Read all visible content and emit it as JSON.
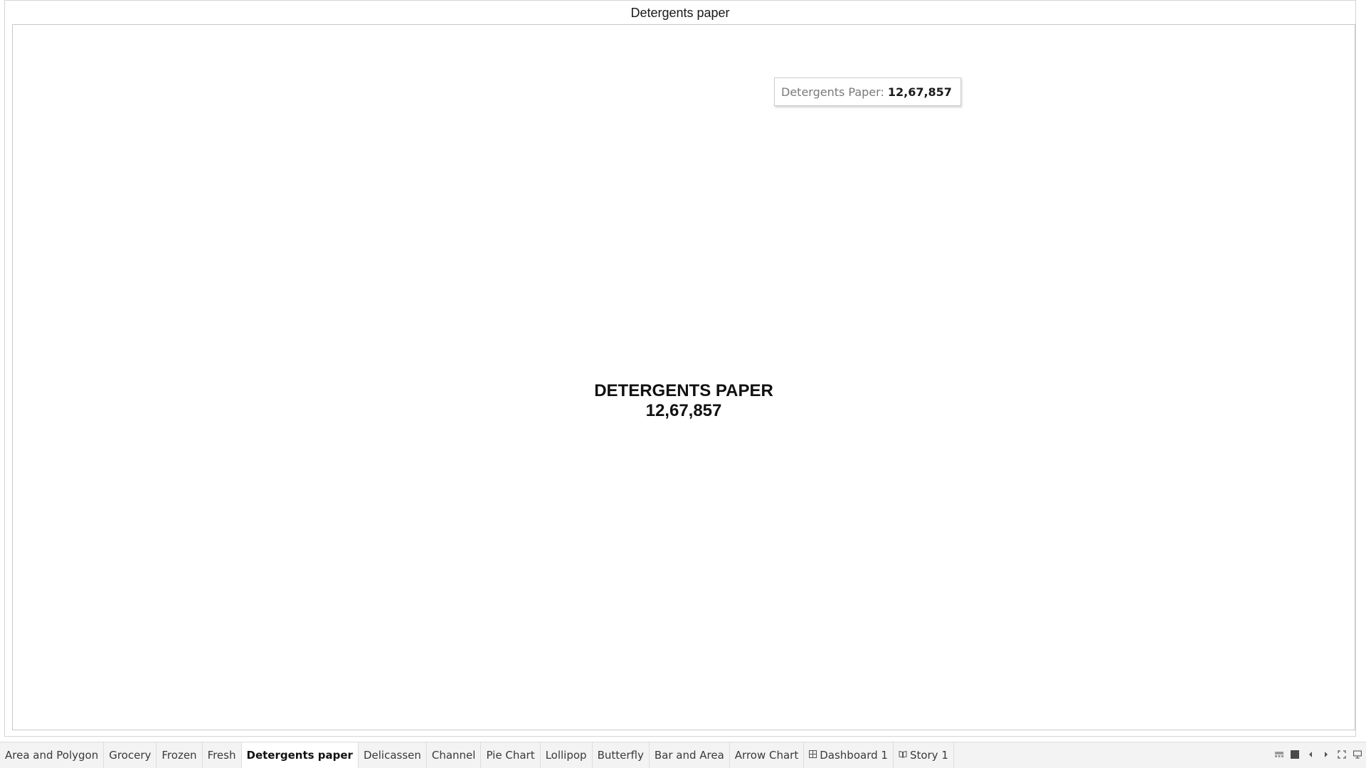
{
  "sheet": {
    "title": "Detergents paper"
  },
  "tooltip": {
    "label": "Detergents Paper:",
    "value": "12,67,857"
  },
  "kpi": {
    "label": "DETERGENTS PAPER",
    "value": "12,67,857"
  },
  "tabs": [
    {
      "label": "Area and Polygon",
      "active": false,
      "icon": null
    },
    {
      "label": "Grocery",
      "active": false,
      "icon": null
    },
    {
      "label": "Frozen",
      "active": false,
      "icon": null
    },
    {
      "label": "Fresh",
      "active": false,
      "icon": null
    },
    {
      "label": "Detergents paper",
      "active": true,
      "icon": null
    },
    {
      "label": "Delicassen",
      "active": false,
      "icon": null
    },
    {
      "label": "Channel",
      "active": false,
      "icon": null
    },
    {
      "label": "Pie Chart",
      "active": false,
      "icon": null
    },
    {
      "label": "Lollipop",
      "active": false,
      "icon": null
    },
    {
      "label": "Butterfly",
      "active": false,
      "icon": null
    },
    {
      "label": "Bar and Area",
      "active": false,
      "icon": null
    },
    {
      "label": "Arrow Chart",
      "active": false,
      "icon": null
    },
    {
      "label": "Dashboard 1",
      "active": false,
      "icon": "dashboard-icon"
    },
    {
      "label": "Story 1",
      "active": false,
      "icon": "story-icon"
    }
  ],
  "nav_controls": [
    "filmstrip-view-icon",
    "tabs-view-icon",
    "previous-sheet-icon",
    "next-sheet-icon",
    "fullscreen-icon",
    "presentation-mode-icon"
  ]
}
